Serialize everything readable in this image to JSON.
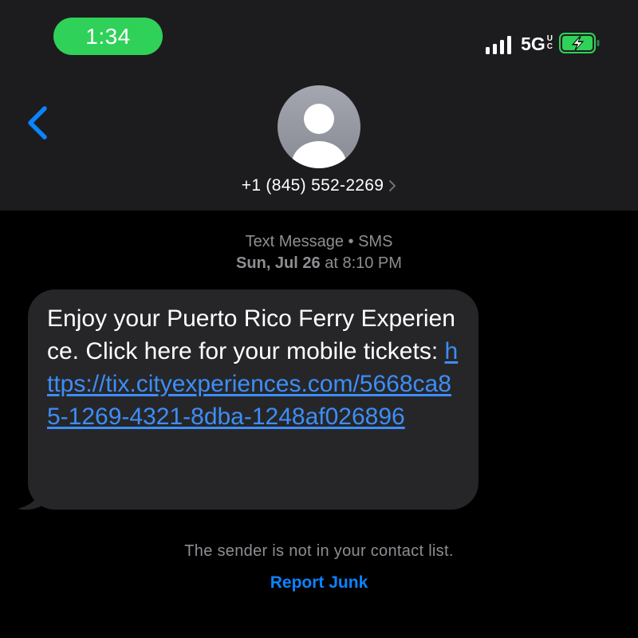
{
  "status_bar": {
    "time": "1:34",
    "time_pill_color": "#30d158",
    "network": "5G",
    "network_suffix_top": "U",
    "network_suffix_bottom": "C",
    "signal_icon": "cellular-signal-icon",
    "battery_icon": "battery-charging-icon"
  },
  "nav": {
    "back_icon": "chevron-left-icon",
    "avatar_icon": "person-icon",
    "contact": "+1 (845) 552-2269",
    "contact_chevron_icon": "chevron-right-icon"
  },
  "thread": {
    "service_label": "Text Message",
    "separator": "•",
    "service_type": "SMS",
    "day": "Sun, Jul 26",
    "at": "at",
    "time": "8:10 PM"
  },
  "message": {
    "text": "Enjoy your Puerto Rico Ferry Experience. Click here for your mobile tickets: ",
    "link": "https://tix.cityexperiences.com/5668ca85-1269-4321-8dba-1248af026896",
    "link_color": "#3d8ef7",
    "bubble_color": "#262629"
  },
  "footer": {
    "note": "The sender is not in your contact list.",
    "report_label": "Report Junk",
    "report_color": "#0a84ff"
  }
}
